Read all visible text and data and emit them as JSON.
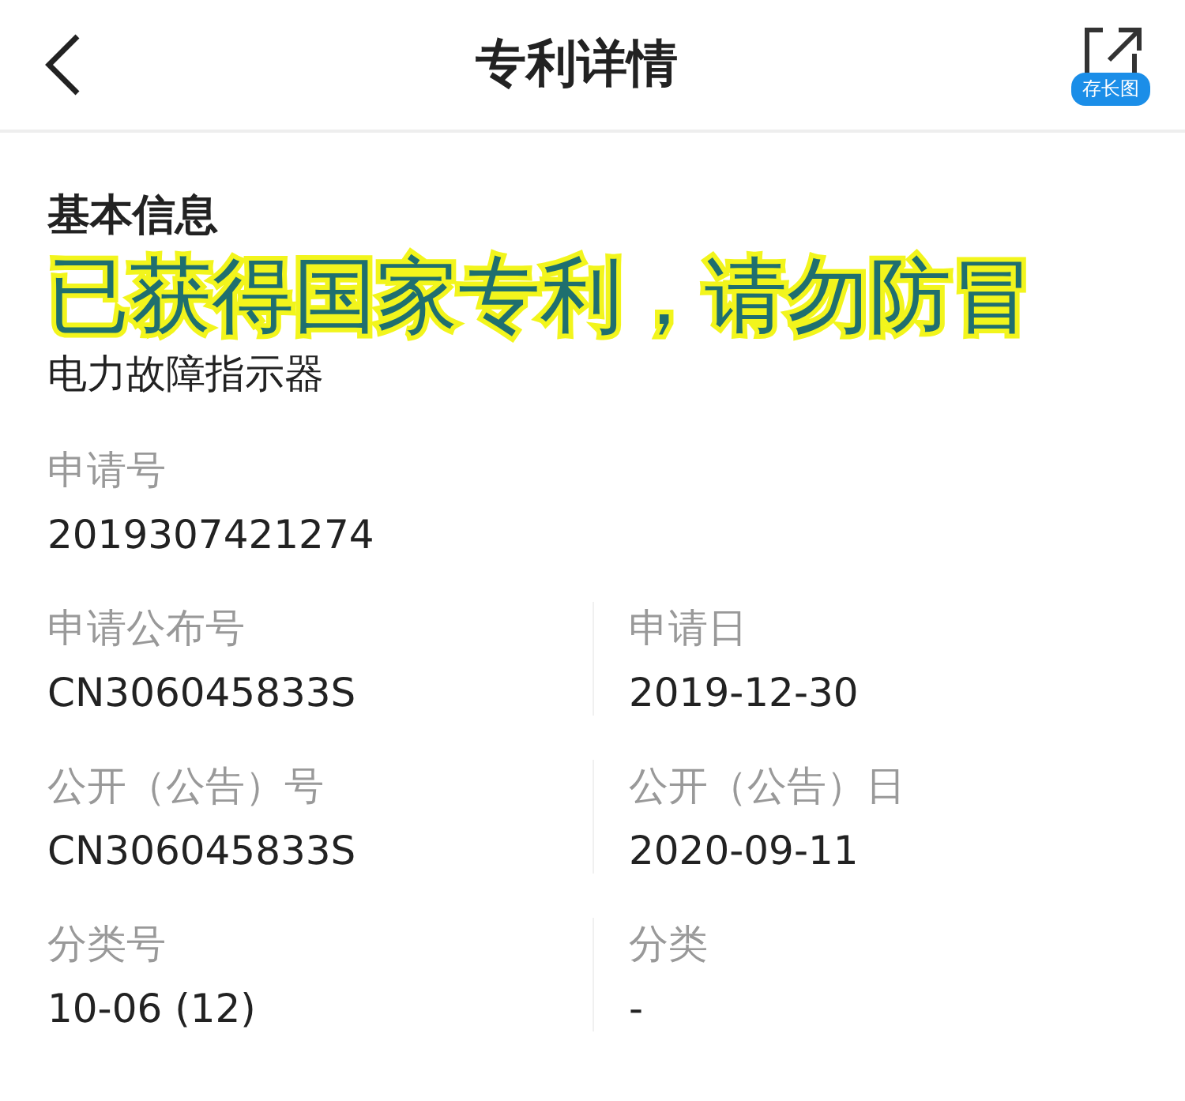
{
  "header": {
    "title": "专利详情",
    "share_label": "存长图"
  },
  "section": {
    "title": "基本信息"
  },
  "banner": "已获得国家专利，请勿防冒",
  "patent_name": "电力故障指示器",
  "field_rows": [
    [
      {
        "label": "申请号",
        "value": "2019307421274"
      }
    ],
    [
      {
        "label": "申请公布号",
        "value": "CN306045833S"
      },
      {
        "label": "申请日",
        "value": "2019-12-30"
      }
    ],
    [
      {
        "label": "公开（公告）号",
        "value": "CN306045833S"
      },
      {
        "label": "公开（公告）日",
        "value": "2020-09-11"
      }
    ],
    [
      {
        "label": "分类号",
        "value": "10-06 (12)"
      },
      {
        "label": "分类",
        "value": "-"
      }
    ]
  ]
}
